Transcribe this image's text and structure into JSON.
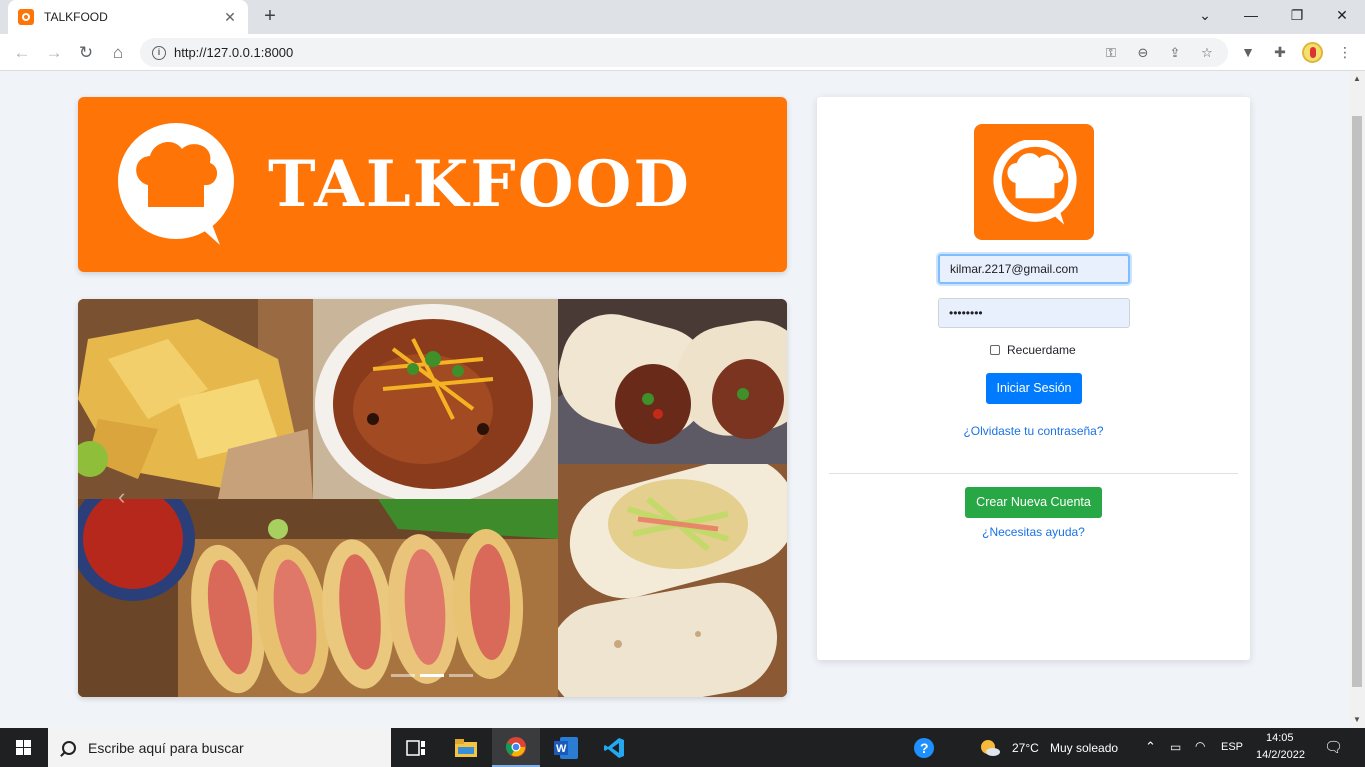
{
  "browser": {
    "tab_title": "TALKFOOD",
    "tab_close": "✕",
    "new_tab": "+",
    "url": "http://127.0.0.1:8000",
    "window_controls": {
      "dropdown": "⌄",
      "minimize": "—",
      "restore": "❐",
      "close": "✕"
    }
  },
  "banner": {
    "brand": "TALKFOOD"
  },
  "carousel": {
    "prev": "‹",
    "photos": [
      "nachos",
      "chili con carne",
      "burritos",
      "tacos",
      "burrito wrap"
    ],
    "slide_count": 3,
    "active_slide": 2
  },
  "login": {
    "email_value": "kilmar.2217@gmail.com",
    "password_value": "••••••••",
    "remember_label": "Recuerdame",
    "login_button": "Iniciar Sesión",
    "forgot_link": "¿Olvidaste tu contraseña?",
    "create_button": "Crear Nueva Cuenta",
    "help_link": "¿Necesitas ayuda?"
  },
  "taskbar": {
    "search_placeholder": "Escribe aquí para buscar",
    "weather_temp": "27°C",
    "weather_desc": "Muy soleado",
    "language": "ESP",
    "time": "14:05",
    "date": "14/2/2022"
  },
  "colors": {
    "brand_orange": "#ff7407",
    "primary_blue": "#007bff",
    "success_green": "#28a745",
    "link_blue": "#1a73e8"
  }
}
